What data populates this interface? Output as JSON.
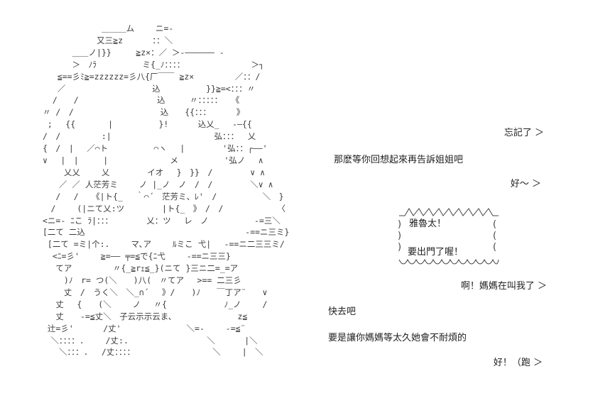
{
  "art": {
    "ascii": "            ＿＿＿ム　　 ニ=-\n           又三≧z　　　 ：：＼\n      ＿＿ノ|}}　　　≧z×：／ ＞-―――――― -\n      ＞　ﾉﾗ　　　　　 ミ{_ﾉ：：：：　　　　　　　　 ＞┐\n   ≦==彡ﾐ≧=zzzzzz=彡八{厂￣￣ ≧z×　　　　　／：：/\n   ／　　　　　　　　　　 込　　　　　 }}≧=<：：：〃\n  /　　/　　　　　　　　　 込　　　〃：：：：：　 《\n〃 /　/　　　　　　　　　　 込　　{{：：：　　　 》\n ;　 {{　　　　|　　　　　 }!　　　 込乂_　 -―{{\n/　/　　　　　:|　　　　　　　　　　　　 弘：：：　 乂\n{　/　|　 ／⌒ト　　　　　 ⌒ヽ　 |　　　　 '弘：：┌――'\n∨　 |　|　　　|　　　　　　　 メ　　　　　 '弘ノ　 ∧\n　　 乂乂　　 乂　　　　 イオ　 }　}}　/　　　　 ∨ ∧\n　　／ ／ 人茫芳ミ　　 ノ |_ノ　ノ　/　/　　　　 ＼∨ ∧\n　 /　 /　 《|ト{_　 ｀⌒´　茫芳ミ、ﾚ'　/　　　　　 ＼　}\n　/　　 (|ニて乂:ツ　　　　 |ト{_　》　/　/　　　　　　 〈\n<ニ=- ﾆこ ﾗ|：：：　　　　 乂：ツ　 レ　ノ　　　　　 -=三＼\n[二て 二込　　　　　　　　　　　　　　　　　　　 -==ニ三ミ}\n [二て =ミ|个:.　　 マ､ア　　 ﾙミこ 弋|　 -==ニ二三三ミ/\n  <ﾆ=彡'　　 ≧=―― ╤=≦で{ﾆ弋　　 -==ニ三三}\n　 てア　　　　　〃{_≧rｪ≦_}(ニて }三ニ二=_=ア\n　　 )ﾉ　r= つ(＼　　)八(　〃てア　 >== 二三彡\n　　 丈　/　うく＼　＼_∩´　 》/　　)ﾉ　　￣丁ア¨　　∨\n　 丈　 {　　(＼　　 ノ　 〃{　　　　　　　ﾉ_ノ　　 /\n　 丈　　-=≦丈＼　子云示示云ま、　　　　　　　　z≦\n 辻=彡'　　　 /丈'　　　　　　　　＼=-　　 -=≦¨\n　＼：：：：.　　 /丈:.　　　　　　　　　 ＼　　　 |＼\n　　＼：：：.　 /丈：：：：　　　　　　　　　　＼　　 |　＼"
  },
  "dialogue": {
    "line1": "忘記了 ＞",
    "line2": "那麽等你回想起來再告訴姐姐吧",
    "line3": "好～ ＞",
    "bubble": {
      "line1": "雅魯太！",
      "line2": "要出門了喔！"
    },
    "line5": "啊！媽媽在叫我了 ＞",
    "line6": "快去吧",
    "line7": "要是讓你媽媽等太久她會不耐煩的",
    "line8": "好！（跑 ＞"
  }
}
